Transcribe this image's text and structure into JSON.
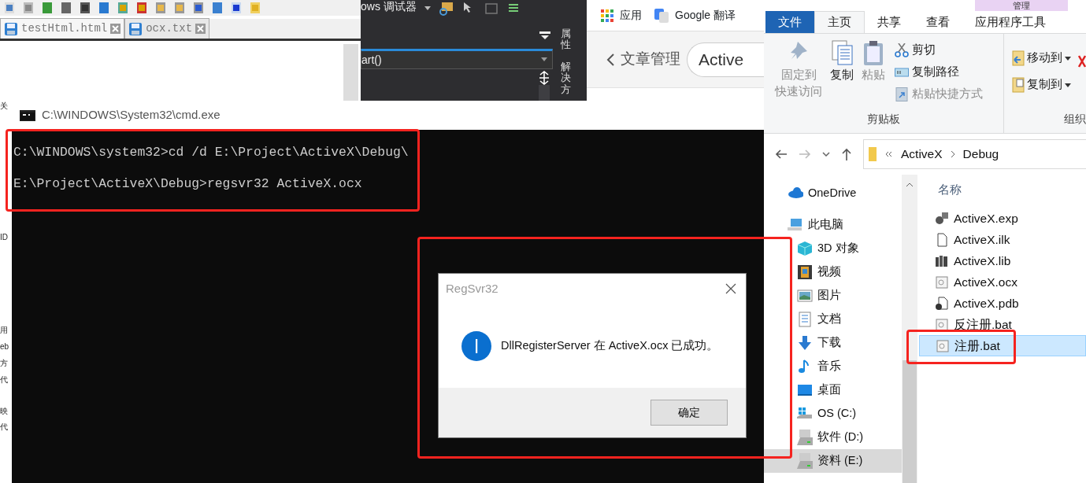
{
  "editor": {
    "tabs": [
      {
        "label": "testHtml.html",
        "selected": true
      },
      {
        "label": "ocx.txt",
        "selected": false
      }
    ],
    "margin_text": [
      "关",
      "ID",
      "用",
      "eb",
      "方",
      "代",
      "映",
      "代"
    ]
  },
  "ide": {
    "toolbar_label": "ows 调试器",
    "dropdown": "art()",
    "side_tabs": [
      "属性",
      "解决方"
    ]
  },
  "browser": {
    "bookmarks": [
      "应用",
      "Google 翻译"
    ],
    "back_label": "文章管理",
    "search": "Active"
  },
  "explorer": {
    "context_header": "管理",
    "tabs": [
      {
        "label": "文件",
        "kind": "file",
        "selected": false
      },
      {
        "label": "主页",
        "kind": "tab",
        "selected": true
      },
      {
        "label": "共享",
        "kind": "tab",
        "selected": false
      },
      {
        "label": "查看",
        "kind": "tab",
        "selected": false
      },
      {
        "label": "应用程序工具",
        "kind": "tab",
        "selected": false
      }
    ],
    "clipboard": {
      "large": [
        {
          "lines": [
            "固定到",
            "快速访问"
          ],
          "disabled": true
        },
        {
          "lines": [
            "复制"
          ],
          "disabled": false
        },
        {
          "lines": [
            "粘贴"
          ],
          "disabled": true
        }
      ],
      "small": [
        {
          "label": "剪切",
          "disabled": false
        },
        {
          "label": "复制路径",
          "disabled": false
        },
        {
          "label": "粘贴快捷方式",
          "disabled": true
        }
      ],
      "group": "剪贴板"
    },
    "organize": {
      "items": [
        "移动到",
        "复制到"
      ],
      "group": "组织"
    },
    "path": [
      "ActiveX",
      "Debug"
    ],
    "nav": [
      {
        "label": "OneDrive",
        "selected": false
      },
      {
        "label": "此电脑",
        "selected": false
      },
      {
        "label": "3D 对象",
        "selected": false
      },
      {
        "label": "视频",
        "selected": false
      },
      {
        "label": "图片",
        "selected": false
      },
      {
        "label": "文档",
        "selected": false
      },
      {
        "label": "下载",
        "selected": false
      },
      {
        "label": "音乐",
        "selected": false
      },
      {
        "label": "桌面",
        "selected": false
      },
      {
        "label": "OS (C:)",
        "selected": false
      },
      {
        "label": "软件 (D:)",
        "selected": false
      },
      {
        "label": "资料 (E:)",
        "selected": true
      }
    ],
    "column": "名称",
    "files": [
      {
        "name": "ActiveX.exp",
        "selected": false,
        "highlighted": false
      },
      {
        "name": "ActiveX.ilk",
        "selected": false,
        "highlighted": false
      },
      {
        "name": "ActiveX.lib",
        "selected": false,
        "highlighted": false
      },
      {
        "name": "ActiveX.ocx",
        "selected": false,
        "highlighted": false
      },
      {
        "name": "ActiveX.pdb",
        "selected": false,
        "highlighted": false
      },
      {
        "name": "反注册.bat",
        "selected": false,
        "highlighted": false
      },
      {
        "name": "注册.bat",
        "selected": true,
        "highlighted": true
      }
    ]
  },
  "cmd": {
    "title": "C:\\WINDOWS\\System32\\cmd.exe",
    "highlighted": true,
    "lines": [
      "C:\\WINDOWS\\system32>cd /d E:\\Project\\ActiveX\\Debug\\",
      "E:\\Project\\ActiveX\\Debug>regsvr32 ActiveX.ocx"
    ]
  },
  "dialog": {
    "title": "RegSvr32",
    "message": "DllRegisterServer 在 ActiveX.ocx 已成功。",
    "button": "确定",
    "highlighted": true
  }
}
